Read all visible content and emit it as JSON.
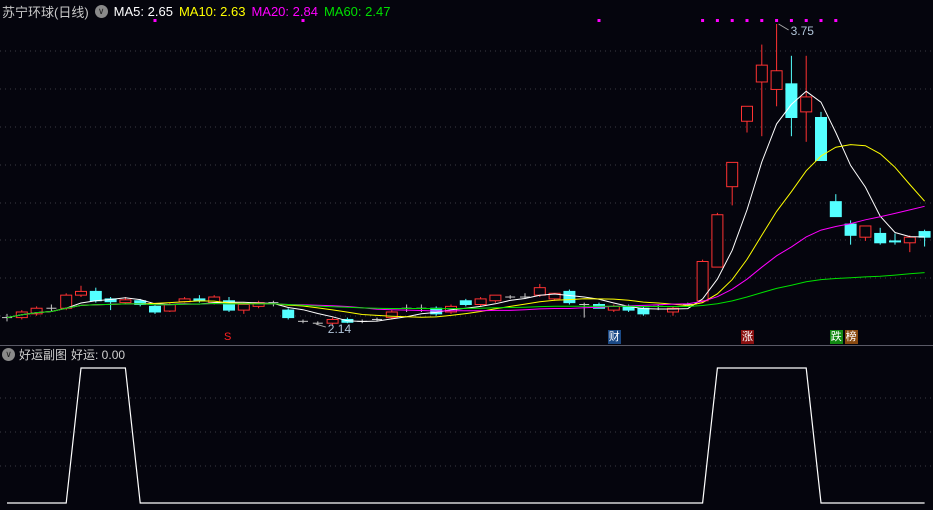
{
  "header": {
    "title": "苏宁环球(日线)",
    "ma5_label": "MA5: 2.65",
    "ma10_label": "MA10: 2.63",
    "ma20_label": "MA20: 2.84",
    "ma60_label": "MA60: 2.47"
  },
  "colors": {
    "ma5": "#ffffff",
    "ma10": "#ffff00",
    "ma20": "#ff00ff",
    "ma60": "#00e000",
    "up": "#ff3232",
    "down": "#54ffff",
    "flat": "#c8c8c8",
    "signal": "#ff00ff"
  },
  "price_labels": {
    "high": "3.75",
    "low": "2.14"
  },
  "signal_tags": [
    {
      "text": "S",
      "color": "#ff2020",
      "bg": "transparent",
      "index": 15
    },
    {
      "text": "财",
      "color": "#ffffff",
      "bg": "#1b4a86",
      "index": 41
    },
    {
      "text": "涨",
      "color": "#ffffff",
      "bg": "#8a1010",
      "index": 50
    },
    {
      "text": "跌",
      "color": "#ffffff",
      "bg": "#128a12",
      "index": 56
    },
    {
      "text": "榜",
      "color": "#ffffff",
      "bg": "#8a4a10",
      "index": 57
    }
  ],
  "sub_panel": {
    "title": "好运副图",
    "value_label": "好运: 0.00"
  },
  "chart_data": {
    "type": "candlestick",
    "price_range": [
      2.02,
      3.86
    ],
    "candles": [
      [
        2.18,
        2.2,
        2.16,
        2.18
      ],
      [
        2.18,
        2.22,
        2.17,
        2.21
      ],
      [
        2.2,
        2.24,
        2.19,
        2.23
      ],
      [
        2.23,
        2.25,
        2.21,
        2.23
      ],
      [
        2.23,
        2.31,
        2.22,
        2.3
      ],
      [
        2.3,
        2.35,
        2.29,
        2.32
      ],
      [
        2.32,
        2.34,
        2.26,
        2.27
      ],
      [
        2.28,
        2.29,
        2.22,
        2.265
      ],
      [
        2.26,
        2.29,
        2.25,
        2.275
      ],
      [
        2.27,
        2.28,
        2.24,
        2.25
      ],
      [
        2.24,
        2.25,
        2.2,
        2.21
      ],
      [
        2.215,
        2.26,
        2.21,
        2.25
      ],
      [
        2.265,
        2.29,
        2.26,
        2.28
      ],
      [
        2.28,
        2.3,
        2.26,
        2.27
      ],
      [
        2.26,
        2.3,
        2.25,
        2.29
      ],
      [
        2.27,
        2.29,
        2.21,
        2.22
      ],
      [
        2.22,
        2.26,
        2.2,
        2.25
      ],
      [
        2.24,
        2.27,
        2.23,
        2.26
      ],
      [
        2.26,
        2.27,
        2.24,
        2.26
      ],
      [
        2.22,
        2.23,
        2.17,
        2.18
      ],
      [
        2.16,
        2.17,
        2.15,
        2.16
      ],
      [
        2.15,
        2.16,
        2.14,
        2.15
      ],
      [
        2.15,
        2.18,
        2.14,
        2.17
      ],
      [
        2.17,
        2.18,
        2.15,
        2.155
      ],
      [
        2.16,
        2.17,
        2.15,
        2.16
      ],
      [
        2.17,
        2.18,
        2.16,
        2.17
      ],
      [
        2.18,
        2.22,
        2.17,
        2.21
      ],
      [
        2.23,
        2.25,
        2.21,
        2.23
      ],
      [
        2.23,
        2.25,
        2.21,
        2.23
      ],
      [
        2.23,
        2.24,
        2.19,
        2.2
      ],
      [
        2.21,
        2.25,
        2.2,
        2.24
      ],
      [
        2.27,
        2.28,
        2.24,
        2.25
      ],
      [
        2.25,
        2.29,
        2.24,
        2.28
      ],
      [
        2.27,
        2.3,
        2.26,
        2.3
      ],
      [
        2.29,
        2.3,
        2.28,
        2.29
      ],
      [
        2.29,
        2.31,
        2.28,
        2.29
      ],
      [
        2.3,
        2.36,
        2.29,
        2.34
      ],
      [
        2.28,
        2.31,
        2.27,
        2.31
      ],
      [
        2.32,
        2.33,
        2.25,
        2.26
      ],
      [
        2.25,
        2.26,
        2.18,
        2.25
      ],
      [
        2.25,
        2.26,
        2.23,
        2.23
      ],
      [
        2.22,
        2.25,
        2.21,
        2.24
      ],
      [
        2.24,
        2.25,
        2.21,
        2.22
      ],
      [
        2.23,
        2.24,
        2.19,
        2.2
      ],
      [
        2.24,
        2.25,
        2.22,
        2.24
      ],
      [
        2.21,
        2.24,
        2.19,
        2.23
      ],
      [
        2.25,
        2.26,
        2.24,
        2.25
      ],
      [
        2.27,
        2.49,
        2.26,
        2.48
      ],
      [
        2.45,
        2.74,
        2.45,
        2.73
      ],
      [
        2.88,
        3.01,
        2.78,
        3.01
      ],
      [
        3.23,
        3.31,
        3.17,
        3.31
      ],
      [
        3.44,
        3.64,
        3.15,
        3.53
      ],
      [
        3.4,
        3.75,
        3.31,
        3.5
      ],
      [
        3.43,
        3.58,
        3.15,
        3.25
      ],
      [
        3.28,
        3.58,
        3.12,
        3.36
      ],
      [
        3.25,
        3.28,
        3.02,
        3.02
      ],
      [
        2.8,
        2.84,
        2.72,
        2.72
      ],
      [
        2.68,
        2.7,
        2.57,
        2.62
      ],
      [
        2.61,
        2.67,
        2.59,
        2.67
      ],
      [
        2.63,
        2.66,
        2.57,
        2.58
      ],
      [
        2.59,
        2.63,
        2.57,
        2.585
      ],
      [
        2.58,
        2.62,
        2.53,
        2.61
      ],
      [
        2.64,
        2.65,
        2.56,
        2.61
      ]
    ],
    "ma_periods": [
      5,
      10,
      20,
      60
    ],
    "signal_dot_indices": [
      10,
      20,
      40,
      47,
      48,
      49,
      50,
      51,
      52,
      53,
      54,
      55,
      56
    ],
    "high_index": 52,
    "low_index": 21,
    "sub_series": [
      0,
      0,
      0,
      0,
      0,
      1,
      1,
      1,
      1,
      0,
      0,
      0,
      0,
      0,
      0,
      0,
      0,
      0,
      0,
      0,
      0,
      0,
      0,
      0,
      0,
      0,
      0,
      0,
      0,
      0,
      0,
      0,
      0,
      0,
      0,
      0,
      0,
      0,
      0,
      0,
      0,
      0,
      0,
      0,
      0,
      0,
      0,
      0,
      1,
      1,
      1,
      1,
      1,
      1,
      1,
      0,
      0,
      0,
      0,
      0,
      0,
      0,
      0
    ],
    "sub_range": [
      0,
      1
    ]
  }
}
